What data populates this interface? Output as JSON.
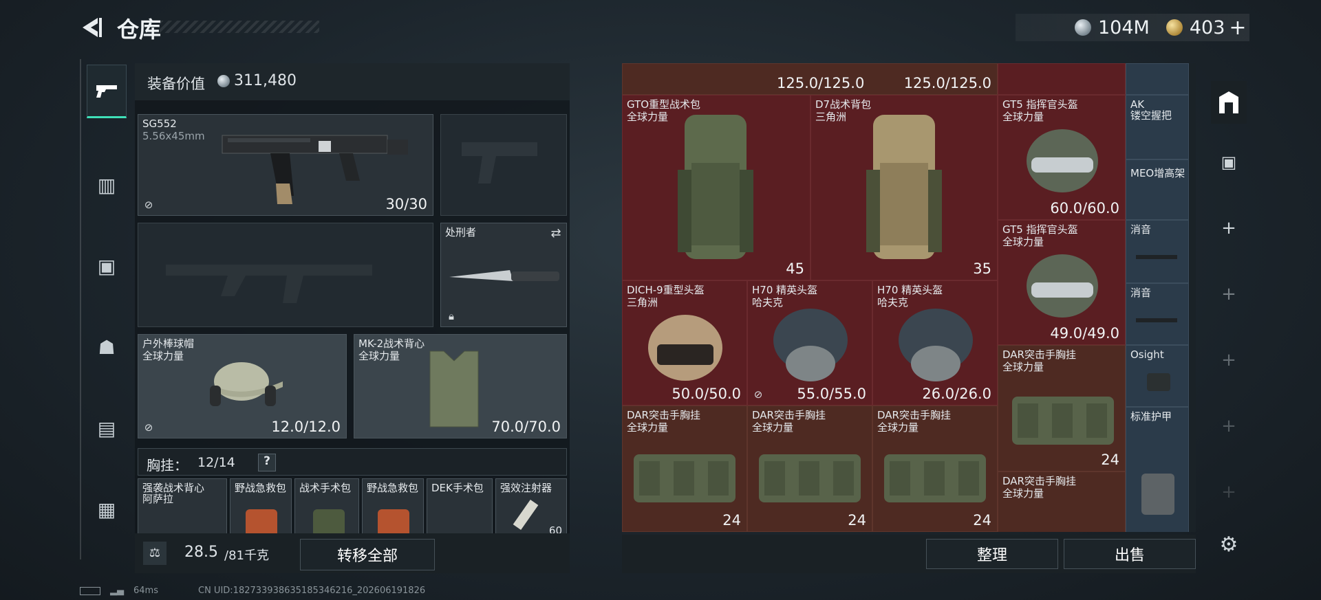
{
  "header": {
    "title": "仓库",
    "silver": "104M",
    "gold": "403"
  },
  "equip_value": {
    "label": "装备价值",
    "value": "311,480"
  },
  "loadout": {
    "primary": {
      "name": "SG552",
      "caliber": "5.56x45mm",
      "ammo": "30/30"
    },
    "melee": {
      "name": "处刑者"
    },
    "helmet": {
      "name": "户外棒球帽",
      "sub": "全球力量",
      "dur": "12.0/12.0"
    },
    "armor": {
      "name": "MK-2战术背心",
      "sub": "全球力量",
      "dur": "70.0/70.0"
    }
  },
  "chest": {
    "label": "胸挂：",
    "count": "12/14",
    "help": "?",
    "items": [
      "强袭战术背心",
      "野战急救包",
      "战术手术包",
      "野战急救包",
      "DEK手术包",
      "强效注射器"
    ],
    "item0_sub": "阿萨拉",
    "item5_count": "60"
  },
  "capacity": {
    "value": "28.5",
    "max": "/81千克"
  },
  "buttons": {
    "transfer_all": "转移全部",
    "sort": "整理",
    "sell": "出售"
  },
  "storage": {
    "top_vals": [
      "125.0/125.0",
      "125.0/125.0"
    ],
    "items": [
      {
        "name": "GTO重型战术包",
        "sub": "全球力量",
        "val": "45"
      },
      {
        "name": "D7战术背包",
        "sub": "三角洲",
        "val": "35"
      },
      {
        "name": "GT5 指挥官头盔",
        "sub": "全球力量",
        "val": "60.0/60.0"
      },
      {
        "name": "GT5 指挥官头盔",
        "sub": "全球力量",
        "val": "49.0/49.0"
      },
      {
        "name": "DICH-9重型头盔",
        "sub": "三角洲",
        "val": "50.0/50.0"
      },
      {
        "name": "H70 精英头盔",
        "sub": "哈夫克",
        "val": "55.0/55.0"
      },
      {
        "name": "H70 精英头盔",
        "sub": "哈夫克",
        "val": "26.0/26.0"
      },
      {
        "name": "DAR突击手胸挂",
        "sub": "全球力量",
        "val": "24"
      },
      {
        "name": "DAR突击手胸挂",
        "sub": "全球力量",
        "val": "24"
      },
      {
        "name": "DAR突击手胸挂",
        "sub": "全球力量",
        "val": "24"
      },
      {
        "name": "DAR突击手胸挂",
        "sub": "全球力量",
        "val": "24"
      },
      {
        "name": "DAR突击手胸挂",
        "sub": "全球力量",
        "val": ""
      }
    ],
    "side": [
      "AK",
      "镂空握把",
      "MEO增高架",
      "消音",
      "消音",
      "Osight",
      "标准护甲"
    ]
  },
  "footer": {
    "ping": "64ms",
    "uid": "CN UID:18273393863518534621​6_202606191826"
  }
}
